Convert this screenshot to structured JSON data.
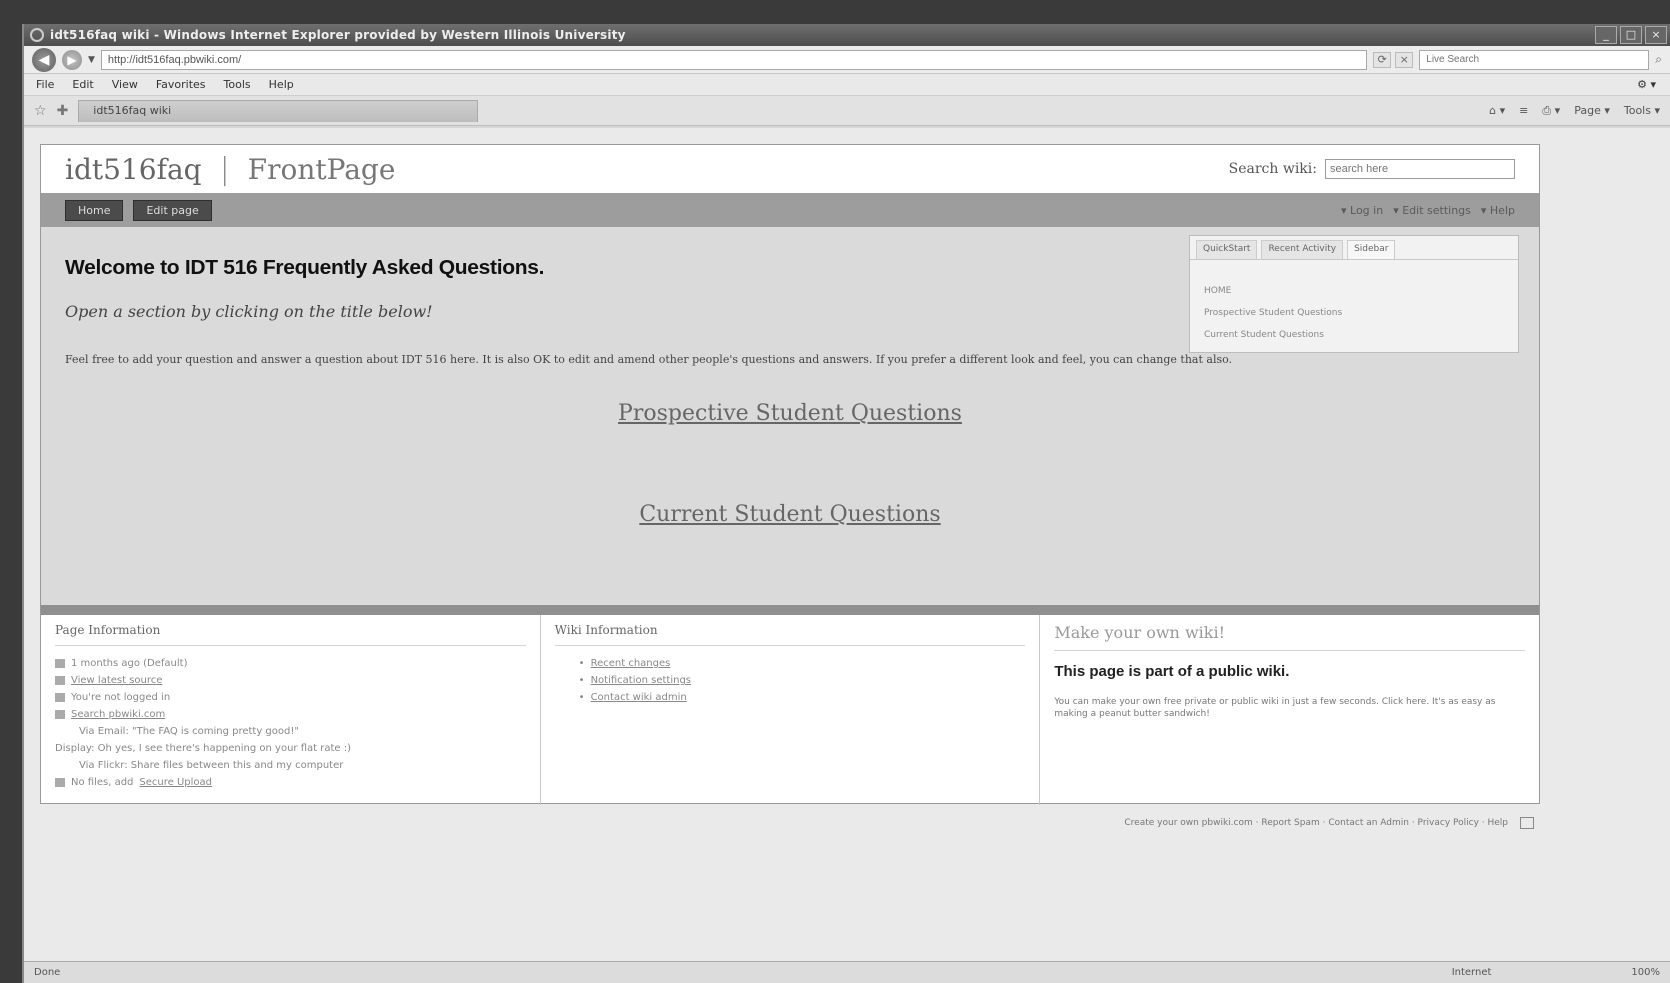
{
  "window": {
    "title": "idt516faq wiki - Windows Internet Explorer provided by Western Illinois University",
    "controls": [
      "_",
      "□",
      "×"
    ]
  },
  "address": {
    "url": "http://idt516faq.pbwiki.com/",
    "search_placeholder": "Live Search"
  },
  "menu": [
    "File",
    "Edit",
    "View",
    "Favorites",
    "Tools",
    "Help"
  ],
  "tab": {
    "label": "idt516faq wiki"
  },
  "commands": [
    "Page ▾",
    "Tools ▾"
  ],
  "wiki": {
    "name": "idt516faq",
    "separator": "|",
    "page": "FrontPage",
    "search_label": "Search wiki:",
    "search_placeholder": "search here",
    "buttons": [
      "Home",
      "Edit page"
    ],
    "right_links": [
      "▾ Log in",
      "▾ Edit settings",
      "▾ Help"
    ]
  },
  "content": {
    "welcome": "Welcome to IDT 516 Frequently Asked Questions.",
    "subtitle": "Open a section by clicking on the title below!",
    "intro": "Feel free to add your question and answer a question about IDT 516 here. It is also OK to edit and amend other people's questions and answers. If you prefer a different look and feel, you can change that also.",
    "link_prospective": "Prospective Student Questions",
    "link_current": "Current Student Questions"
  },
  "sidebox": {
    "tabs": [
      "QuickStart",
      "Recent Activity",
      "Sidebar"
    ],
    "links": [
      "HOME",
      "Prospective Student Questions",
      "Current Student Questions"
    ]
  },
  "footer": {
    "page_info": {
      "title": "Page Information",
      "rows": [
        "1 months ago (Default)",
        "View latest source",
        "You're not logged in",
        "Search pbwiki.com"
      ],
      "note1": "Via Email: \"The FAQ is coming pretty good!\"",
      "note2": "Display: Oh yes, I see there's happening on your flat rate :)",
      "note3": "Via Flickr: Share files between this and my computer",
      "note4": "No files, add",
      "note4_link": "Secure Upload"
    },
    "wiki_info": {
      "title": "Wiki Information",
      "items": [
        "Recent changes",
        "Notification settings",
        "Contact wiki admin"
      ]
    },
    "make_wiki": {
      "title": "Make your own wiki!",
      "public": "This page is part of a public wiki.",
      "text": "You can make your own free private or public wiki in just a few seconds. Click here. It's as easy as making a peanut butter sandwich!"
    }
  },
  "page_footer": "Create your own pbwiki.com · Report Spam · Contact an Admin · Privacy Policy · Help",
  "status": {
    "left": "Done",
    "zone": "Internet",
    "zoom": "100%"
  }
}
